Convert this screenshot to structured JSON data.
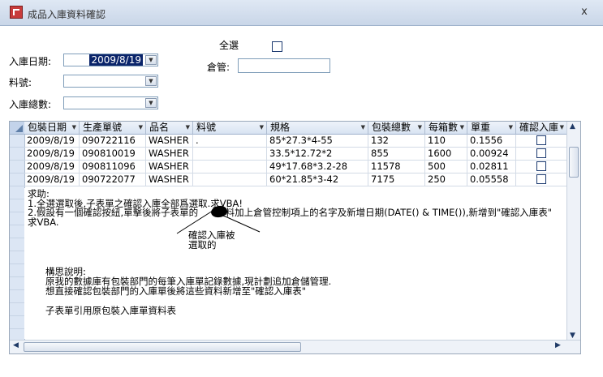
{
  "window": {
    "title": "成品入庫資料確認",
    "close": "x"
  },
  "form": {
    "select_all_label": "全選",
    "date_label": "入庫日期:",
    "date_value": "2009/8/19",
    "warehouse_label": "倉管:",
    "warehouse_value": "",
    "part_label": "料號:",
    "part_value": "",
    "total_label": "入庫總數:",
    "total_value": ""
  },
  "grid": {
    "columns": [
      "包裝日期",
      "生產單號",
      "品名",
      "料號",
      "規格",
      "包裝總數",
      "每箱數",
      "單重",
      "確認入庫"
    ],
    "rows": [
      {
        "date": "2009/8/19",
        "order": "090722116",
        "name": "WASHER",
        "part": ".",
        "spec": "85*27.3*4-55",
        "total": "132",
        "per_box": "110",
        "weight": "0.1556"
      },
      {
        "date": "2009/8/19",
        "order": "090810019",
        "name": "WASHER",
        "part": "",
        "spec": "33.5*12.72*2",
        "total": "855",
        "per_box": "1600",
        "weight": "0.00924"
      },
      {
        "date": "2009/8/19",
        "order": "090811096",
        "name": "WASHER",
        "part": "",
        "spec": "49*17.68*3.2-28",
        "total": "11578",
        "per_box": "500",
        "weight": "0.02811"
      },
      {
        "date": "2009/8/19",
        "order": "090722077",
        "name": "WASHER",
        "part": "",
        "spec": "60*21.85*3-42",
        "total": "7175",
        "per_box": "250",
        "weight": "0.05558"
      }
    ]
  },
  "note": {
    "lines": [
      "求助:",
      "1.全選選取後,子表單之確認入庫全部爲選取.求VBA!",
      "2.假設有一個確認按紐,單擊後將子表單的",
      "資料加上倉管控制項上的名字及新增日期(DATE() & TIME()),新增到\"確認入庫表\"",
      "求VBA.",
      "確認入庫被",
      "選取的",
      "構思說明:",
      "原我的數據庫有包裝部門的每筆入庫單記錄數據,現計劃追加倉儲管理.",
      "想直接確認包裝部門的入庫單後將這些資料新增至\"確認入庫表\"",
      "子表單引用原包裝入庫單資料表"
    ]
  }
}
